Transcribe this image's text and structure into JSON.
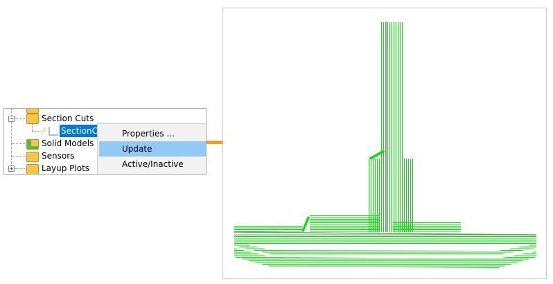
{
  "tree": {
    "items": [
      {
        "label": "Section Cuts",
        "expander": "−"
      },
      {
        "label": "SectionCuts",
        "selected": true
      },
      {
        "label": "Solid Models"
      },
      {
        "label": "Sensors"
      },
      {
        "label": "Layup Plots",
        "expander": "+"
      }
    ]
  },
  "context_menu": {
    "items": [
      {
        "label": "Properties ..."
      },
      {
        "label": "Update",
        "highlighted": true
      },
      {
        "label": "Active/Inactive"
      }
    ]
  },
  "colors": {
    "arrow": "#f0a01e",
    "mesh": "#00e600",
    "selection": "#0078d7",
    "highlight": "#91c9f7"
  }
}
